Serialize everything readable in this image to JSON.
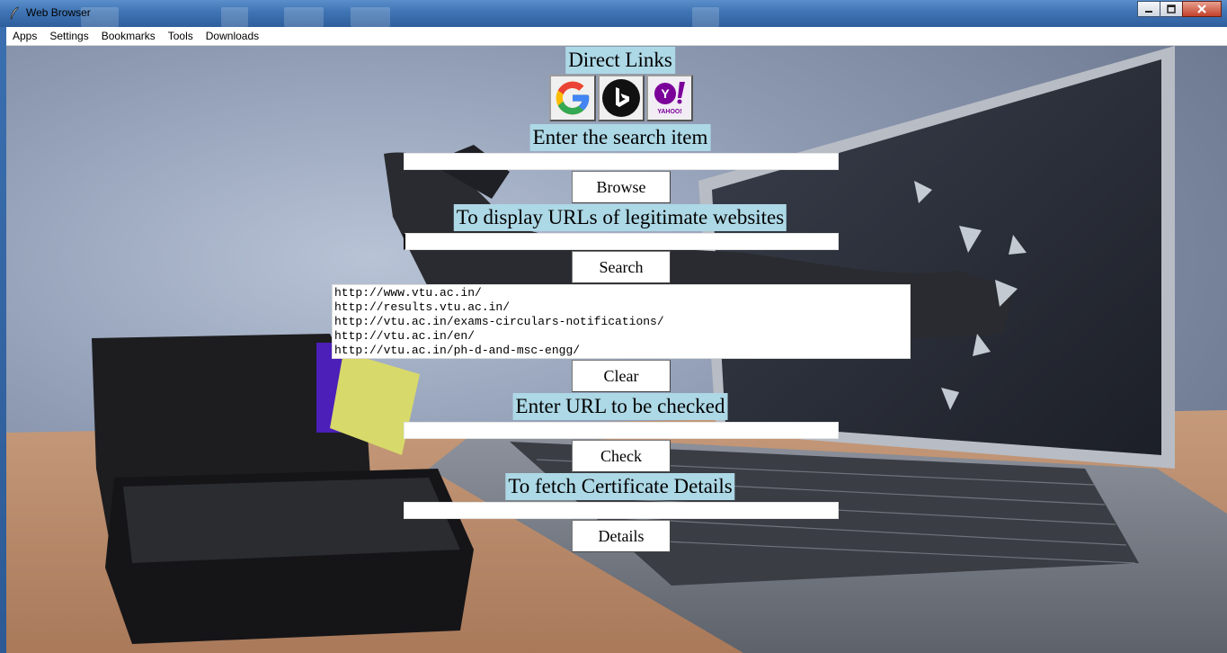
{
  "window": {
    "title": "Web Browser"
  },
  "menubar": {
    "items": [
      "Apps",
      "Settings",
      "Bookmarks",
      "Tools",
      "Downloads"
    ]
  },
  "direct_links": {
    "label": "Direct Links",
    "buttons": [
      {
        "name": "google",
        "icon": "google-icon"
      },
      {
        "name": "bing",
        "icon": "bing-icon"
      },
      {
        "name": "yahoo",
        "icon": "yahoo-icon",
        "text": "YAHOO!"
      }
    ]
  },
  "search_item": {
    "label": "Enter the search item",
    "value": "",
    "button": "Browse"
  },
  "legit_urls": {
    "label": "To display URLs of legitimate websites",
    "value": "",
    "button": "Search",
    "results": [
      "http://www.vtu.ac.in/",
      "http://results.vtu.ac.in/",
      "http://vtu.ac.in/exams-circulars-notifications/",
      "http://vtu.ac.in/en/",
      "http://vtu.ac.in/ph-d-and-msc-engg/"
    ],
    "clear_button": "Clear"
  },
  "check_url": {
    "label": "Enter URL to be checked",
    "value": "",
    "button": "Check"
  },
  "certificate": {
    "label": "To fetch Certificate Details",
    "value": "",
    "button": "Details"
  },
  "colors": {
    "label_bg": "#add8e6",
    "titlebar": "#3f74b4",
    "google_blue": "#4285f4",
    "google_red": "#ea4335",
    "google_yellow": "#fbbc05",
    "google_green": "#34a853",
    "yahoo_purple": "#7b0099"
  }
}
